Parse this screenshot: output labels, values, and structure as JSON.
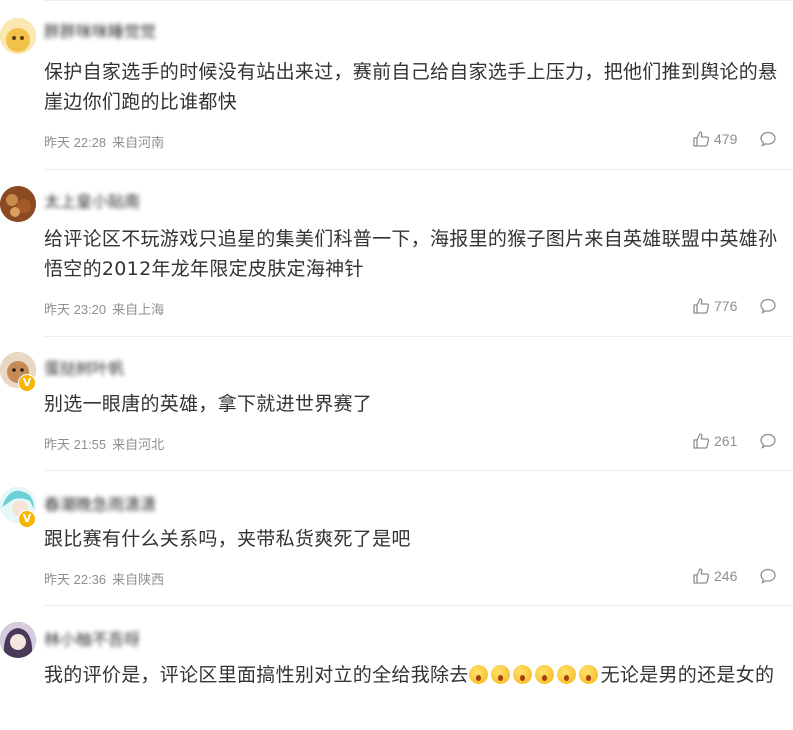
{
  "comments": [
    {
      "username": "胖胖咪咪睡觉觉",
      "text": "保护自家选手的时候没有站出来过，赛前自己给自家选手上压力，把他们推到舆论的悬崖边你们跑的比谁都快",
      "time": "昨天 22:28",
      "location": "来自河南",
      "likes": "479",
      "avatar_color": "#f2c96a",
      "verified": false
    },
    {
      "username": "太上皇小贴南",
      "text": "给评论区不玩游戏只追星的集美们科普一下，海报里的猴子图片来自英雄联盟中英雄孙悟空的2012年龙年限定皮肤定海神针",
      "time": "昨天 23:20",
      "location": "来自上海",
      "likes": "776",
      "avatar_color": "#b06a3a",
      "verified": false
    },
    {
      "username": "蛋挞树叶帆",
      "text": "别选一眼唐的英雄，拿下就进世界赛了",
      "time": "昨天 21:55",
      "location": "来自河北",
      "likes": "261",
      "avatar_color": "#c9a98a",
      "verified": true
    },
    {
      "username": "春潮晚急雨潇潇",
      "text": "跟比赛有什么关系吗，夹带私货爽死了是吧",
      "time": "昨天 22:36",
      "location": "来自陕西",
      "likes": "246",
      "avatar_color": "#7fd0d8",
      "verified": true
    },
    {
      "username": "林小柚不吾呀",
      "text": "我的评价是，评论区里面搞性别对立的全给我除去",
      "text_after": "无论是男的还是女的",
      "emoji_count": 6,
      "avatar_color": "#6f5b7a",
      "verified": false
    }
  ],
  "colors": {
    "accent_badge": "#f7b500",
    "meta_text": "#8f8f8f",
    "body_text": "#333333"
  }
}
